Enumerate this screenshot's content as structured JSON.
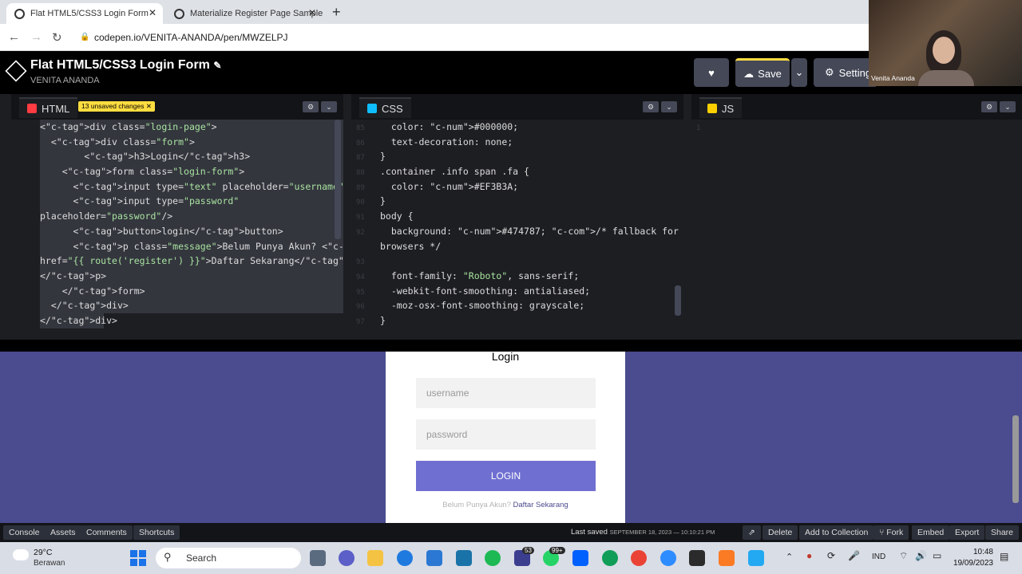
{
  "browser": {
    "tabs": [
      {
        "label": "Flat HTML5/CSS3 Login Form"
      },
      {
        "label": "Materialize Register Page Sample"
      }
    ],
    "url": "codepen.io/VENITA-ANANDA/pen/MWZELPJ"
  },
  "codepen": {
    "title": "Flat HTML5/CSS3 Login Form",
    "author": "VENITA ANANDA",
    "save_label": "Save",
    "settings_label": "Settings"
  },
  "panels": {
    "html": {
      "label": "HTML",
      "badge": "13 unsaved changes"
    },
    "css": {
      "label": "CSS"
    },
    "js": {
      "label": "JS",
      "line1": "1"
    }
  },
  "html_code": [
    "<div class=\"login-page\">",
    "  <div class=\"form\">",
    "        <h3>Login</h3>",
    "    <form class=\"login-form\">",
    "      <input type=\"text\" placeholder=\"username\"/>",
    "      <input type=\"password\"",
    "placeholder=\"password\"/>",
    "      <button>login</button>",
    "      <p class=\"message\">Belum Punya Akun? <a",
    "href=\"{{ route('register') }}\">Daftar Sekarang</a>",
    "</p>",
    "    </form>",
    "  </div>",
    "</div>"
  ],
  "css_code": [
    "  color: #000000;",
    "  text-decoration: none;",
    "}",
    ".container .info span .fa {",
    "  color: #EF3B3A;",
    "}",
    "body {",
    "  background: #474787; /* fallback for old",
    "browsers */",
    "",
    "  font-family: \"Roboto\", sans-serif;",
    "  -webkit-font-smoothing: antialiased;",
    "  -moz-osx-font-smoothing: grayscale;",
    "}"
  ],
  "css_line_numbers": [
    "85",
    "86",
    "87",
    "88",
    "89",
    "90",
    "91",
    "92",
    "",
    "93",
    "94",
    "95",
    "96",
    "97"
  ],
  "preview": {
    "heading": "Login",
    "username_placeholder": "username",
    "password_placeholder": "password",
    "button": "LOGIN",
    "message": "Belum Punya Akun?",
    "link": "Daftar Sekarang",
    "background": "#4b4b8f"
  },
  "footer": {
    "console": "Console",
    "assets": "Assets",
    "comments": "Comments",
    "shortcuts": "Shortcuts",
    "last_saved_label": "Last saved",
    "last_saved_value": "SEPTEMBER 18, 2023 — 10:10:21 PM",
    "delete": "Delete",
    "add_to_collection": "Add to Collection",
    "fork": "Fork",
    "embed": "Embed",
    "export": "Export",
    "share": "Share"
  },
  "taskbar": {
    "weather_temp": "29°C",
    "weather_desc": "Berawan",
    "search": "Search",
    "lang": "IND",
    "time": "10:48",
    "date": "19/09/2023",
    "badge_1": "53",
    "badge_2": "99+"
  },
  "webcam": {
    "name": "Venita Ananda"
  }
}
